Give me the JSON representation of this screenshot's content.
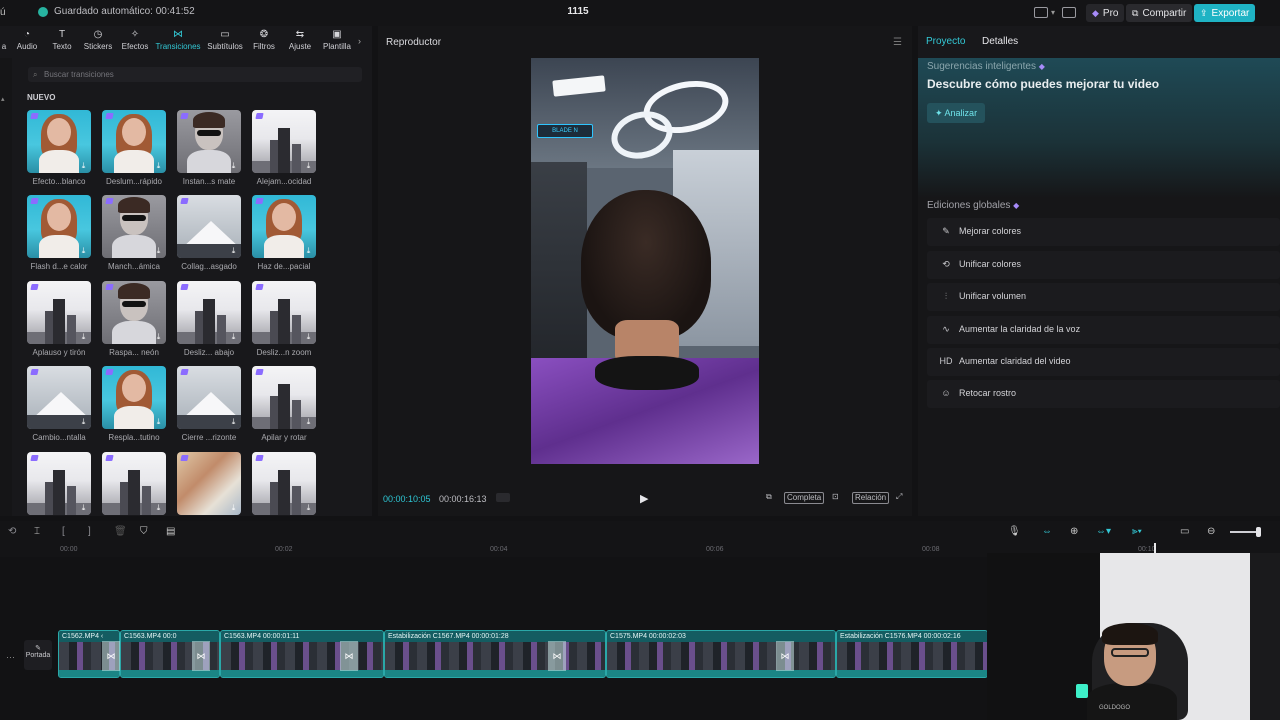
{
  "titlebar": {
    "menu_fragment": "ú",
    "autosave": "Guardado automático: 00:41:52",
    "project_title": "1115",
    "pro_label": "Pro",
    "share_label": "Compartir",
    "export_label": "Exportar"
  },
  "toolbar": {
    "items": [
      {
        "label": "a",
        "icon": "cut-icon"
      },
      {
        "label": "Audio",
        "icon": "audio-icon"
      },
      {
        "label": "Texto",
        "icon": "text-icon"
      },
      {
        "label": "Stickers",
        "icon": "sticker-icon"
      },
      {
        "label": "Efectos",
        "icon": "effects-icon"
      },
      {
        "label": "Transiciones",
        "icon": "transitions-icon",
        "active": true
      },
      {
        "label": "Subtítulos",
        "icon": "subtitles-icon"
      },
      {
        "label": "Filtros",
        "icon": "filters-icon"
      },
      {
        "label": "Ajuste",
        "icon": "adjust-icon"
      },
      {
        "label": "Plantilla",
        "icon": "template-icon"
      }
    ]
  },
  "transitions": {
    "search_placeholder": "Buscar transiciones",
    "section": "NUEVO",
    "items": [
      {
        "label": "Efecto...blanco",
        "thumb": "teal"
      },
      {
        "label": "Deslum...rápido",
        "thumb": "teal"
      },
      {
        "label": "Instan...s mate",
        "thumb": "gray"
      },
      {
        "label": "Alejam...ocidad",
        "thumb": "city"
      },
      {
        "label": "Flash d...e calor",
        "thumb": "teal"
      },
      {
        "label": "Manch...ámica",
        "thumb": "gray"
      },
      {
        "label": "Collag...asgado",
        "thumb": "mountain"
      },
      {
        "label": "Haz de...pacial",
        "thumb": "teal"
      },
      {
        "label": "Aplauso y tirón",
        "thumb": "city"
      },
      {
        "label": "Raspa... neón",
        "thumb": "gray"
      },
      {
        "label": "Desliz... abajo",
        "thumb": "city"
      },
      {
        "label": "Desliz...n zoom",
        "thumb": "city"
      },
      {
        "label": "Cambio...ntalla",
        "thumb": "mountain"
      },
      {
        "label": "Respla...tutino",
        "thumb": "teal"
      },
      {
        "label": "Cierre ...rizonte",
        "thumb": "mountain"
      },
      {
        "label": "Apilar y rotar",
        "thumb": "city"
      },
      {
        "label": "",
        "thumb": "city"
      },
      {
        "label": "",
        "thumb": "city"
      },
      {
        "label": "",
        "thumb": "blur"
      },
      {
        "label": "",
        "thumb": "city"
      }
    ]
  },
  "player": {
    "title": "Reproductor",
    "current_time": "00:00:10:05",
    "total_time": "00:00:16:13",
    "full_label": "Completa",
    "ratio_label": "Relación",
    "neon_sign": "BLADE N"
  },
  "right_panel": {
    "tabs": [
      "Proyecto",
      "Detalles"
    ],
    "smart_label": "Sugerencias inteligentes",
    "smart_headline": "Descubre cómo puedes mejorar tu video",
    "analyze_label": "Analizar",
    "global_label": "Ediciones globales",
    "global_items": [
      {
        "label": "Mejorar colores",
        "icon": "magic-wand-icon",
        "glyph": "✎"
      },
      {
        "label": "Unificar colores",
        "icon": "color-match-icon",
        "glyph": "⟲"
      },
      {
        "label": "Unificar volumen",
        "icon": "volume-sliders-icon",
        "glyph": "⫶"
      },
      {
        "label": "Aumentar la claridad de la voz",
        "icon": "voice-wave-icon",
        "glyph": "∿"
      },
      {
        "label": "Aumentar claridad del video",
        "icon": "hd-icon",
        "glyph": "HD"
      },
      {
        "label": "Retocar rostro",
        "icon": "face-retouch-icon",
        "glyph": "☺"
      }
    ]
  },
  "timeline": {
    "ticks": [
      "00:00",
      "00:02",
      "00:04",
      "00:06",
      "00:08",
      "00:10"
    ],
    "cover_label": "Portada",
    "clips": [
      {
        "label": "C1562.MP4  ‹"
      },
      {
        "label": "C1563.MP4  00:0"
      },
      {
        "label": "C1563.MP4  00:00:01:11"
      },
      {
        "label": "Estabilización  C1567.MP4  00:00:01:28"
      },
      {
        "label": "C1575.MP4  00:00:02:03"
      },
      {
        "label": "Estabilización  C1576.MP4  00:00:02:16"
      }
    ]
  },
  "webcam": {
    "shirt_text": "GOLDOGO"
  }
}
